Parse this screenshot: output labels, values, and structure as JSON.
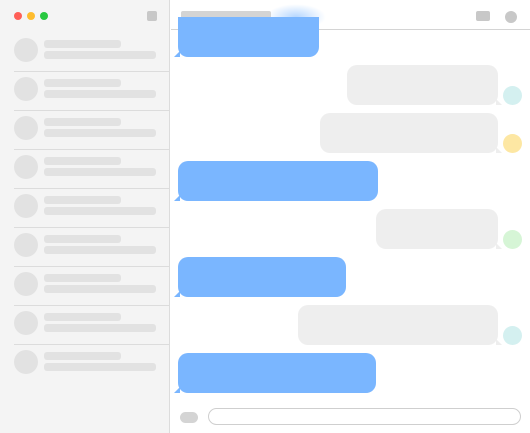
{
  "window": {
    "traffic_lights": {
      "close": "#ff5f57",
      "minimize": "#febc2e",
      "zoom": "#28c840"
    }
  },
  "sidebar": {
    "compose_icon": "compose-icon",
    "conversations": [
      {
        "avatar_color": "#e2e2e2",
        "name": "",
        "preview": ""
      },
      {
        "avatar_color": "#e2e2e2",
        "name": "",
        "preview": ""
      },
      {
        "avatar_color": "#e2e2e2",
        "name": "",
        "preview": ""
      },
      {
        "avatar_color": "#e2e2e2",
        "name": "",
        "preview": ""
      },
      {
        "avatar_color": "#e2e2e2",
        "name": "",
        "preview": ""
      },
      {
        "avatar_color": "#e2e2e2",
        "name": "",
        "preview": ""
      },
      {
        "avatar_color": "#e2e2e2",
        "name": "",
        "preview": ""
      },
      {
        "avatar_color": "#e2e2e2",
        "name": "",
        "preview": ""
      },
      {
        "avatar_color": "#e2e2e2",
        "name": "",
        "preview": ""
      }
    ]
  },
  "header": {
    "title": "",
    "video_icon": "video-call-icon",
    "info_icon": "info-icon"
  },
  "messages": {
    "colors": {
      "incoming": "#7ab6ff",
      "outgoing": "#eeeeee"
    },
    "items": [
      {
        "direction": "incoming",
        "text": ""
      },
      {
        "direction": "outgoing",
        "text": "",
        "avatar_color": "#d4f0f0"
      },
      {
        "direction": "outgoing",
        "text": "",
        "avatar_color": "#fde7a3"
      },
      {
        "direction": "incoming",
        "text": ""
      },
      {
        "direction": "outgoing",
        "text": "",
        "avatar_color": "#d6f5d6"
      },
      {
        "direction": "incoming",
        "text": ""
      },
      {
        "direction": "outgoing",
        "text": "",
        "avatar_color": "#d4f0f0"
      },
      {
        "direction": "incoming",
        "text": ""
      }
    ]
  },
  "composer": {
    "apps_icon": "apps-icon",
    "input_value": "",
    "input_placeholder": ""
  }
}
